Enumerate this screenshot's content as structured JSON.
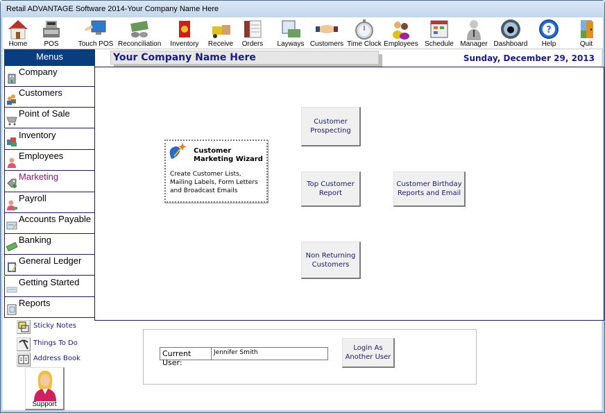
{
  "window": {
    "title": "Retail ADVANTAGE Software 2014-Your Company Name Here"
  },
  "toolbar": {
    "items": [
      {
        "label": "Home",
        "icon": "home-icon"
      },
      {
        "label": "POS",
        "icon": "cash-register-icon"
      },
      {
        "label": "Touch POS",
        "icon": "touch-screen-icon"
      },
      {
        "label": "Reconciliation",
        "icon": "money-coins-icon"
      },
      {
        "label": "Inventory",
        "icon": "inventory-box-icon"
      },
      {
        "label": "Receive",
        "icon": "forklift-icon"
      },
      {
        "label": "Orders",
        "icon": "orders-document-icon"
      },
      {
        "label": "Layways",
        "icon": "layaway-calendar-icon"
      },
      {
        "label": "Customers",
        "icon": "handshake-icon"
      },
      {
        "label": "Time Clock",
        "icon": "stopwatch-icon"
      },
      {
        "label": "Employees",
        "icon": "people-group-icon"
      },
      {
        "label": "Schedule",
        "icon": "schedule-calendar-icon"
      },
      {
        "label": "Manager",
        "icon": "manager-person-icon"
      },
      {
        "label": "Dashboard",
        "icon": "gauge-icon"
      },
      {
        "label": "Help",
        "icon": "help-question-icon"
      },
      {
        "label": "Quit",
        "icon": "exit-door-icon"
      }
    ]
  },
  "sidebar": {
    "header": "Menus",
    "active": "Marketing",
    "items": [
      {
        "label": "Company",
        "icon": "building-icon"
      },
      {
        "label": "Customers",
        "icon": "customers-icon"
      },
      {
        "label": "Point of Sale",
        "icon": "shopping-cart-icon"
      },
      {
        "label": "Inventory",
        "icon": "boxes-icon"
      },
      {
        "label": "Employees",
        "icon": "employee-icon"
      },
      {
        "label": "Marketing",
        "icon": "marketing-tag-icon"
      },
      {
        "label": "Payroll",
        "icon": "payroll-icon"
      },
      {
        "label": "Accounts Payable",
        "icon": "pencil-form-icon"
      },
      {
        "label": "Banking",
        "icon": "cash-bill-icon"
      },
      {
        "label": "General Ledger",
        "icon": "ledger-book-icon"
      },
      {
        "label": "Getting Started",
        "icon": "keyboard-icon"
      },
      {
        "label": "Reports",
        "icon": "report-icon"
      }
    ]
  },
  "header": {
    "company_name": "Your Company Name Here",
    "date": "Sunday, December 29, 2013"
  },
  "main": {
    "wizard": {
      "title": "Customer\nMarketing Wizard",
      "description": "Create Customer Lists,\nMailing Labels, Form Letters\nand Broadcast Emails"
    },
    "buttons": {
      "prospecting": "Customer\nProspecting",
      "top_customer": "Top Customer\nReport",
      "birthday": "Customer Birthday\nReports and Email",
      "non_returning": "Non Returning\nCustomers"
    }
  },
  "quick_links": [
    {
      "label": "Sticky Notes",
      "icon": "sticky-note-icon"
    },
    {
      "label": "Things To Do",
      "icon": "pickaxe-icon"
    },
    {
      "label": "Address Book",
      "icon": "address-book-icon"
    }
  ],
  "support": {
    "label": "Support"
  },
  "user_panel": {
    "label": "Current User:",
    "value": "Jennifer Smith",
    "login_button": "Login As\nAnother User"
  }
}
